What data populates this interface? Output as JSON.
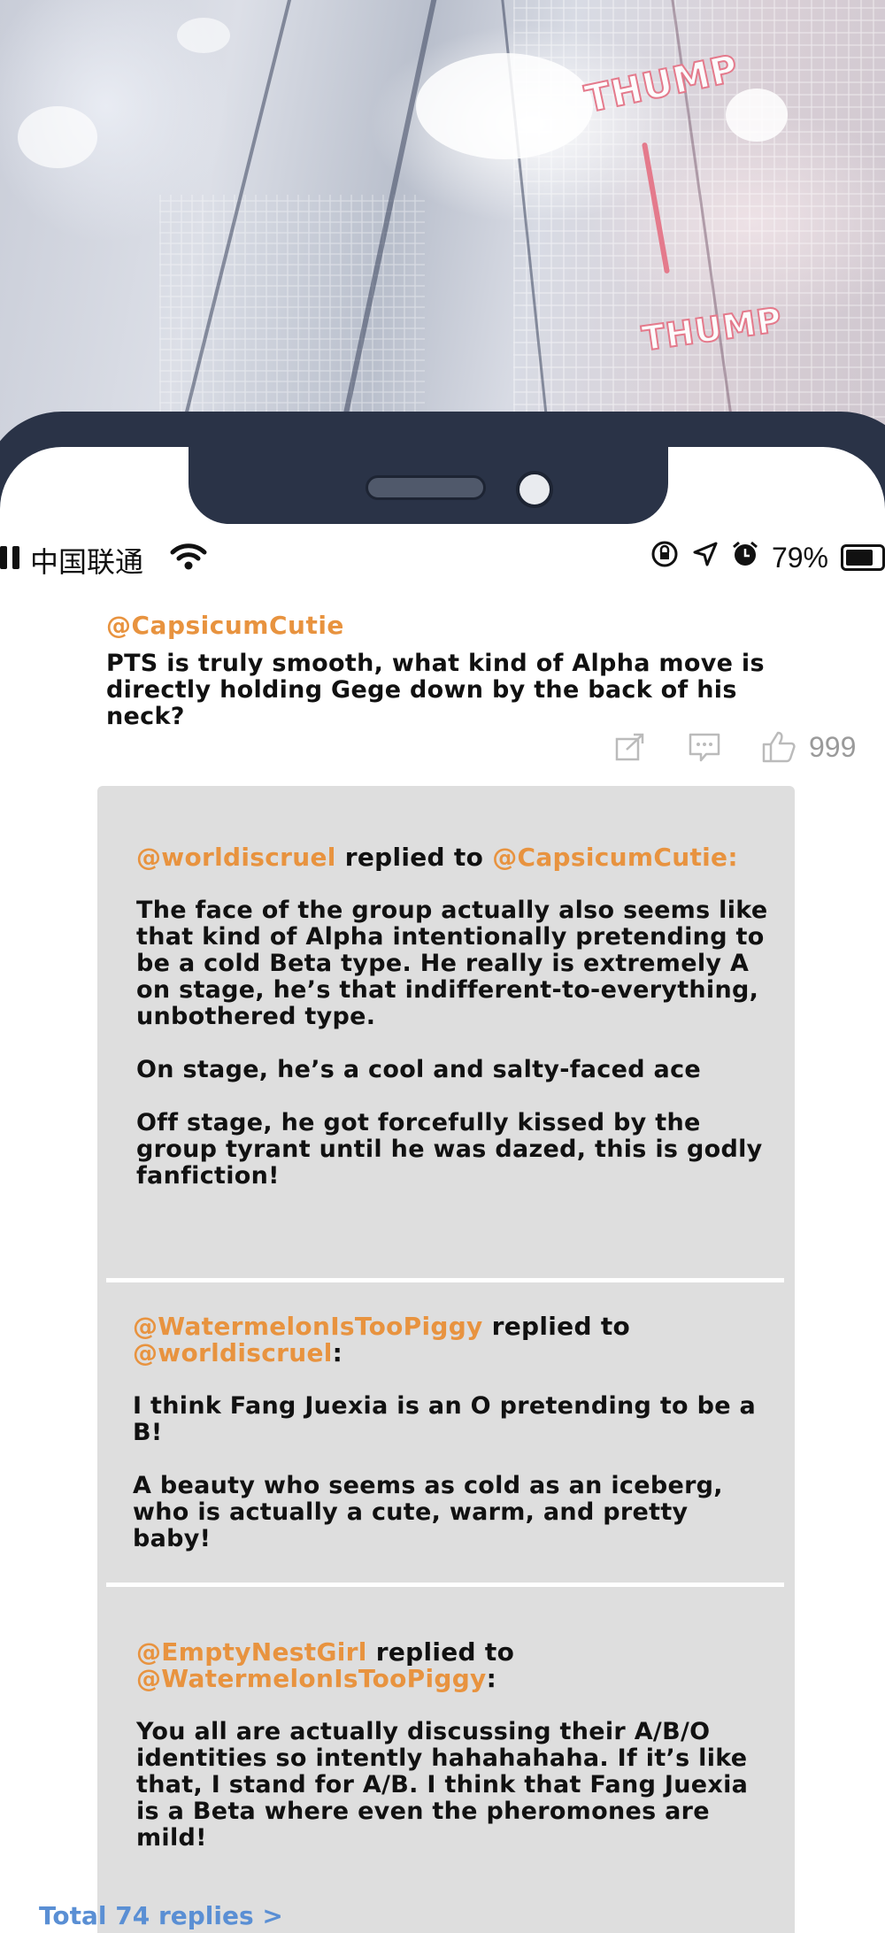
{
  "art": {
    "sfx": [
      "THUMP",
      "THUMP"
    ]
  },
  "status_bar": {
    "carrier": "中国联通",
    "battery_percent": "79%",
    "battery_level": 0.79
  },
  "comment": {
    "username": "@CapsicumCutie",
    "text": "PTS is truly smooth, what kind of Alpha move is directly holding Gege down by the back of his neck?",
    "like_count": "999",
    "icons": [
      "share-icon",
      "comment-icon",
      "like-icon"
    ]
  },
  "replies": [
    {
      "author": "@worldiscruel",
      "connector": " replied to ",
      "target": "@CapsicumCutie:",
      "paragraphs": [
        "The face of the group actually also seems like that kind of Alpha intentionally pretending to be a cold Beta type. He really is extremely A on stage, he’s that indifferent-to-everything, unbothered type.",
        "On stage, he’s a cool and salty-faced ace",
        "Off stage, he got forcefully kissed by the group tyrant until he was dazed, this is godly fanfiction!"
      ]
    },
    {
      "author": "@WatermelonIsTooPiggy",
      "connector": " replied to ",
      "target": "@worldiscruel",
      "suffix": ":",
      "paragraphs": [
        "I think Fang Juexia is an O pretending to be a B!",
        "A beauty who seems as cold as an iceberg, who is actually a cute, warm, and pretty baby!"
      ]
    },
    {
      "author": "@EmptyNestGirl",
      "connector": " replied to ",
      "target": "@WatermelonIsTooPiggy",
      "suffix": ":",
      "paragraphs": [
        "You all are actually discussing their A/B/O identities so intently hahahahaha. If it’s like that, I stand for A/B. I think that Fang Juexia is a Beta where even the pheromones are mild!"
      ]
    }
  ],
  "total_replies": "Total 74 replies >"
}
